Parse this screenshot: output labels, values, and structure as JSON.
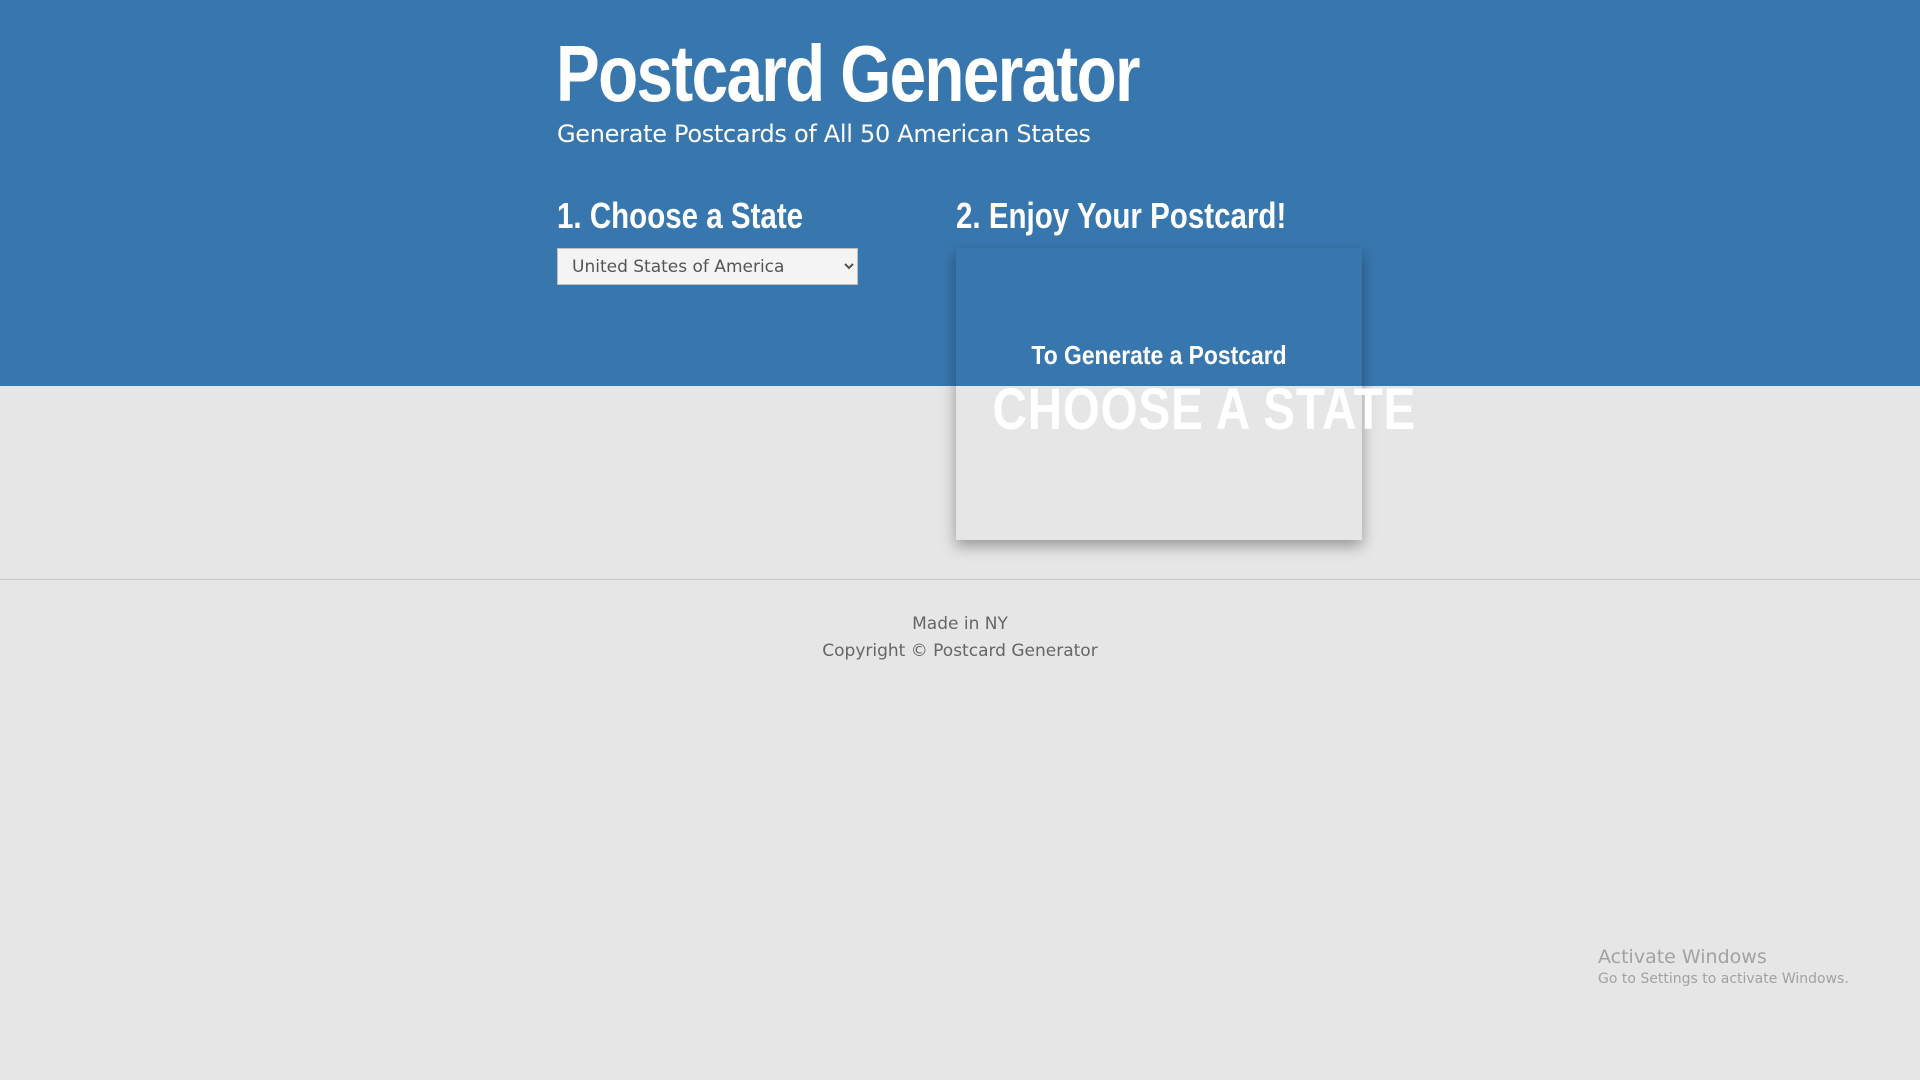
{
  "header": {
    "title": "Postcard Generator",
    "subtitle": "Generate Postcards of All 50 American States"
  },
  "steps": {
    "choose": {
      "heading": "1. Choose a State",
      "select": {
        "selected": "United States of America",
        "options": [
          "United States of America"
        ]
      }
    },
    "enjoy": {
      "heading": "2. Enjoy Your Postcard!"
    }
  },
  "postcard": {
    "line1": "To Generate a Postcard",
    "line2": "CHOOSE A STATE"
  },
  "footer": {
    "made_in": "Made in NY",
    "copyright": "Copyright © Postcard Generator"
  },
  "os_watermark": {
    "title": "Activate Windows",
    "subtitle": "Go to Settings to activate Windows."
  },
  "colors": {
    "hero_blue": "#3877ae",
    "page_background": "#e6e6e6",
    "text_white": "#ffffff",
    "footer_text": "#666666"
  }
}
